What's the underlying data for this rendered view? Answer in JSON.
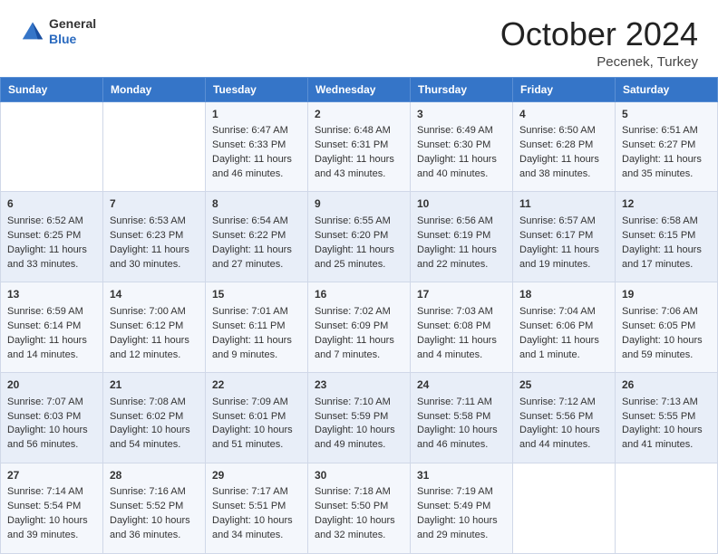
{
  "header": {
    "logo_general": "General",
    "logo_blue": "Blue",
    "month": "October 2024",
    "location": "Pecenek, Turkey"
  },
  "days_of_week": [
    "Sunday",
    "Monday",
    "Tuesday",
    "Wednesday",
    "Thursday",
    "Friday",
    "Saturday"
  ],
  "weeks": [
    [
      {
        "day": "",
        "sunrise": "",
        "sunset": "",
        "daylight": ""
      },
      {
        "day": "",
        "sunrise": "",
        "sunset": "",
        "daylight": ""
      },
      {
        "day": "1",
        "sunrise": "Sunrise: 6:47 AM",
        "sunset": "Sunset: 6:33 PM",
        "daylight": "Daylight: 11 hours and 46 minutes."
      },
      {
        "day": "2",
        "sunrise": "Sunrise: 6:48 AM",
        "sunset": "Sunset: 6:31 PM",
        "daylight": "Daylight: 11 hours and 43 minutes."
      },
      {
        "day": "3",
        "sunrise": "Sunrise: 6:49 AM",
        "sunset": "Sunset: 6:30 PM",
        "daylight": "Daylight: 11 hours and 40 minutes."
      },
      {
        "day": "4",
        "sunrise": "Sunrise: 6:50 AM",
        "sunset": "Sunset: 6:28 PM",
        "daylight": "Daylight: 11 hours and 38 minutes."
      },
      {
        "day": "5",
        "sunrise": "Sunrise: 6:51 AM",
        "sunset": "Sunset: 6:27 PM",
        "daylight": "Daylight: 11 hours and 35 minutes."
      }
    ],
    [
      {
        "day": "6",
        "sunrise": "Sunrise: 6:52 AM",
        "sunset": "Sunset: 6:25 PM",
        "daylight": "Daylight: 11 hours and 33 minutes."
      },
      {
        "day": "7",
        "sunrise": "Sunrise: 6:53 AM",
        "sunset": "Sunset: 6:23 PM",
        "daylight": "Daylight: 11 hours and 30 minutes."
      },
      {
        "day": "8",
        "sunrise": "Sunrise: 6:54 AM",
        "sunset": "Sunset: 6:22 PM",
        "daylight": "Daylight: 11 hours and 27 minutes."
      },
      {
        "day": "9",
        "sunrise": "Sunrise: 6:55 AM",
        "sunset": "Sunset: 6:20 PM",
        "daylight": "Daylight: 11 hours and 25 minutes."
      },
      {
        "day": "10",
        "sunrise": "Sunrise: 6:56 AM",
        "sunset": "Sunset: 6:19 PM",
        "daylight": "Daylight: 11 hours and 22 minutes."
      },
      {
        "day": "11",
        "sunrise": "Sunrise: 6:57 AM",
        "sunset": "Sunset: 6:17 PM",
        "daylight": "Daylight: 11 hours and 19 minutes."
      },
      {
        "day": "12",
        "sunrise": "Sunrise: 6:58 AM",
        "sunset": "Sunset: 6:15 PM",
        "daylight": "Daylight: 11 hours and 17 minutes."
      }
    ],
    [
      {
        "day": "13",
        "sunrise": "Sunrise: 6:59 AM",
        "sunset": "Sunset: 6:14 PM",
        "daylight": "Daylight: 11 hours and 14 minutes."
      },
      {
        "day": "14",
        "sunrise": "Sunrise: 7:00 AM",
        "sunset": "Sunset: 6:12 PM",
        "daylight": "Daylight: 11 hours and 12 minutes."
      },
      {
        "day": "15",
        "sunrise": "Sunrise: 7:01 AM",
        "sunset": "Sunset: 6:11 PM",
        "daylight": "Daylight: 11 hours and 9 minutes."
      },
      {
        "day": "16",
        "sunrise": "Sunrise: 7:02 AM",
        "sunset": "Sunset: 6:09 PM",
        "daylight": "Daylight: 11 hours and 7 minutes."
      },
      {
        "day": "17",
        "sunrise": "Sunrise: 7:03 AM",
        "sunset": "Sunset: 6:08 PM",
        "daylight": "Daylight: 11 hours and 4 minutes."
      },
      {
        "day": "18",
        "sunrise": "Sunrise: 7:04 AM",
        "sunset": "Sunset: 6:06 PM",
        "daylight": "Daylight: 11 hours and 1 minute."
      },
      {
        "day": "19",
        "sunrise": "Sunrise: 7:06 AM",
        "sunset": "Sunset: 6:05 PM",
        "daylight": "Daylight: 10 hours and 59 minutes."
      }
    ],
    [
      {
        "day": "20",
        "sunrise": "Sunrise: 7:07 AM",
        "sunset": "Sunset: 6:03 PM",
        "daylight": "Daylight: 10 hours and 56 minutes."
      },
      {
        "day": "21",
        "sunrise": "Sunrise: 7:08 AM",
        "sunset": "Sunset: 6:02 PM",
        "daylight": "Daylight: 10 hours and 54 minutes."
      },
      {
        "day": "22",
        "sunrise": "Sunrise: 7:09 AM",
        "sunset": "Sunset: 6:01 PM",
        "daylight": "Daylight: 10 hours and 51 minutes."
      },
      {
        "day": "23",
        "sunrise": "Sunrise: 7:10 AM",
        "sunset": "Sunset: 5:59 PM",
        "daylight": "Daylight: 10 hours and 49 minutes."
      },
      {
        "day": "24",
        "sunrise": "Sunrise: 7:11 AM",
        "sunset": "Sunset: 5:58 PM",
        "daylight": "Daylight: 10 hours and 46 minutes."
      },
      {
        "day": "25",
        "sunrise": "Sunrise: 7:12 AM",
        "sunset": "Sunset: 5:56 PM",
        "daylight": "Daylight: 10 hours and 44 minutes."
      },
      {
        "day": "26",
        "sunrise": "Sunrise: 7:13 AM",
        "sunset": "Sunset: 5:55 PM",
        "daylight": "Daylight: 10 hours and 41 minutes."
      }
    ],
    [
      {
        "day": "27",
        "sunrise": "Sunrise: 7:14 AM",
        "sunset": "Sunset: 5:54 PM",
        "daylight": "Daylight: 10 hours and 39 minutes."
      },
      {
        "day": "28",
        "sunrise": "Sunrise: 7:16 AM",
        "sunset": "Sunset: 5:52 PM",
        "daylight": "Daylight: 10 hours and 36 minutes."
      },
      {
        "day": "29",
        "sunrise": "Sunrise: 7:17 AM",
        "sunset": "Sunset: 5:51 PM",
        "daylight": "Daylight: 10 hours and 34 minutes."
      },
      {
        "day": "30",
        "sunrise": "Sunrise: 7:18 AM",
        "sunset": "Sunset: 5:50 PM",
        "daylight": "Daylight: 10 hours and 32 minutes."
      },
      {
        "day": "31",
        "sunrise": "Sunrise: 7:19 AM",
        "sunset": "Sunset: 5:49 PM",
        "daylight": "Daylight: 10 hours and 29 minutes."
      },
      {
        "day": "",
        "sunrise": "",
        "sunset": "",
        "daylight": ""
      },
      {
        "day": "",
        "sunrise": "",
        "sunset": "",
        "daylight": ""
      }
    ]
  ]
}
